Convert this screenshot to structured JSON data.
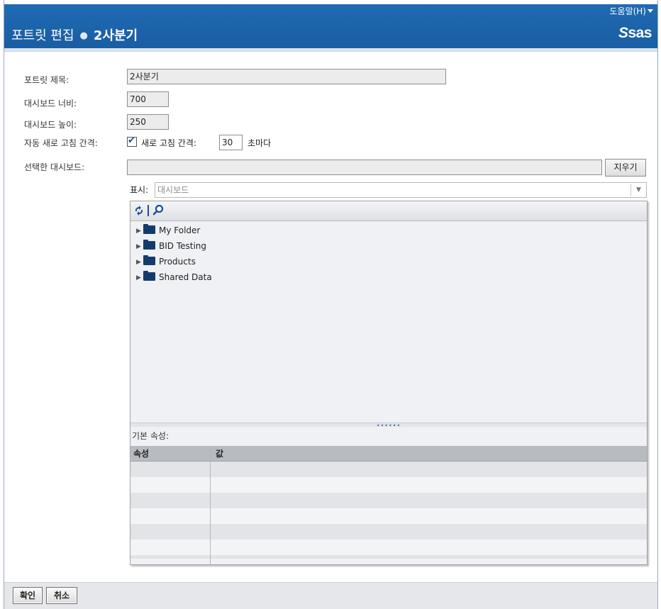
{
  "header": {
    "help_label": "도움말(H)",
    "title": "포트릿 편집",
    "subtitle": "2사분기",
    "logo_text": "sas"
  },
  "form": {
    "portlet_title_label": "포트릿 제목:",
    "portlet_title_value": "2사분기",
    "dashboard_width_label": "대시보드 너비:",
    "dashboard_width_value": "700",
    "dashboard_height_label": "대시보드 높이:",
    "dashboard_height_value": "250",
    "auto_refresh_label": "자동 새로 고침 간격:",
    "auto_refresh_checked": true,
    "refresh_interval_label": "새로 고침 간격:",
    "refresh_interval_value": "30",
    "refresh_interval_unit": "초마다",
    "selected_dashboard_label": "선택한 대시보드:",
    "selected_dashboard_value": "",
    "clear_button": "지우기",
    "show_label": "표시:",
    "show_select_value": "대시보드"
  },
  "tree": {
    "items": [
      {
        "label": "My Folder"
      },
      {
        "label": "BID Testing"
      },
      {
        "label": "Products"
      },
      {
        "label": "Shared Data"
      }
    ]
  },
  "properties": {
    "label": "기본 속성:",
    "columns": [
      "속성",
      "값"
    ],
    "rows": 6
  },
  "footer": {
    "ok_button": "확인",
    "cancel_button": "취소"
  },
  "colors": {
    "header_blue": "#1f6bb3",
    "folder": "#153b6d"
  }
}
